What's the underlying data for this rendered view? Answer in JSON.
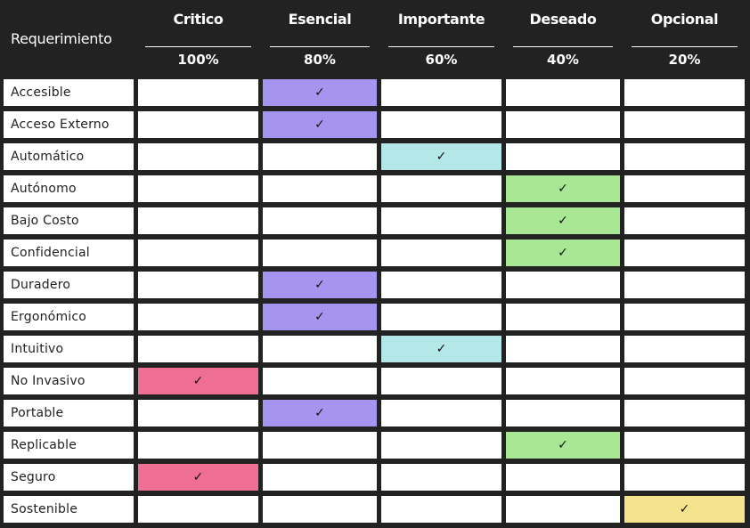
{
  "header": {
    "label": "Requerimiento"
  },
  "columns": [
    {
      "name": "Critico",
      "weight": "100%",
      "color": "#ee6f93"
    },
    {
      "name": "Esencial",
      "weight": "80%",
      "color": "#a595ee"
    },
    {
      "name": "Importante",
      "weight": "60%",
      "color": "#b4e8e8"
    },
    {
      "name": "Deseado",
      "weight": "40%",
      "color": "#a8e894"
    },
    {
      "name": "Opcional",
      "weight": "20%",
      "color": "#f5e38d"
    }
  ],
  "check_glyph": "✓",
  "rows": [
    {
      "label": "Accesible",
      "priority": 1
    },
    {
      "label": "Acceso Externo",
      "priority": 1
    },
    {
      "label": "Automático",
      "priority": 2
    },
    {
      "label": "Autónomo",
      "priority": 3
    },
    {
      "label": "Bajo Costo",
      "priority": 3
    },
    {
      "label": "Confidencial",
      "priority": 3
    },
    {
      "label": "Duradero",
      "priority": 1
    },
    {
      "label": "Ergonómico",
      "priority": 1
    },
    {
      "label": "Intuitivo",
      "priority": 2
    },
    {
      "label": "No Invasivo",
      "priority": 0
    },
    {
      "label": "Portable",
      "priority": 1
    },
    {
      "label": "Replicable",
      "priority": 3
    },
    {
      "label": "Seguro",
      "priority": 0
    },
    {
      "label": "Sostenible",
      "priority": 4
    }
  ]
}
